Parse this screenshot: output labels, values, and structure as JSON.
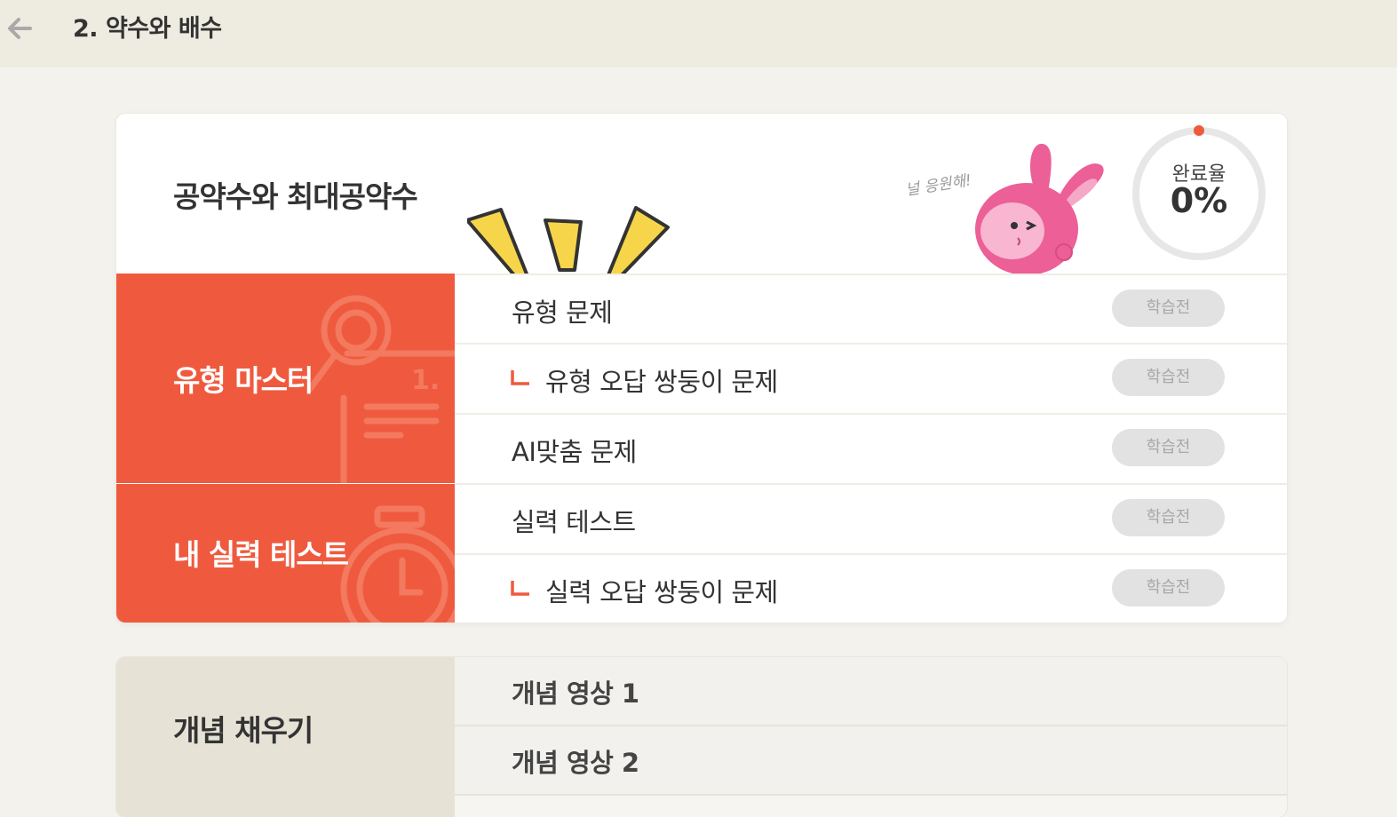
{
  "header": {
    "title": "2. 약수와 배수",
    "back_icon": "back-arrow-icon"
  },
  "unit": {
    "title": "공약수와 최대공약수",
    "cheer_text": "널 응원해!",
    "progress": {
      "label": "완료율",
      "value_text": "0%",
      "fraction": 0
    },
    "colors": {
      "accent": "#ef5a3e",
      "status_bg": "#e2e2e2"
    },
    "sections": [
      {
        "label": "유형 마스터",
        "items": [
          {
            "label": "유형 문제",
            "status": "학습전"
          },
          {
            "label": "유형 오답 쌍둥이 문제",
            "status": "학습전"
          },
          {
            "label": "AI맞춤 문제",
            "status": "학습전"
          }
        ]
      },
      {
        "label": "내 실력 테스트",
        "items": [
          {
            "label": "실력 테스트",
            "status": "학습전"
          },
          {
            "label": "실력 오답 쌍둥이 문제",
            "status": "학습전"
          }
        ]
      }
    ]
  },
  "next_section": {
    "label": "개념 채우기",
    "items": [
      {
        "label": "개념 영상 1"
      },
      {
        "label": "개념 영상 2"
      }
    ]
  }
}
